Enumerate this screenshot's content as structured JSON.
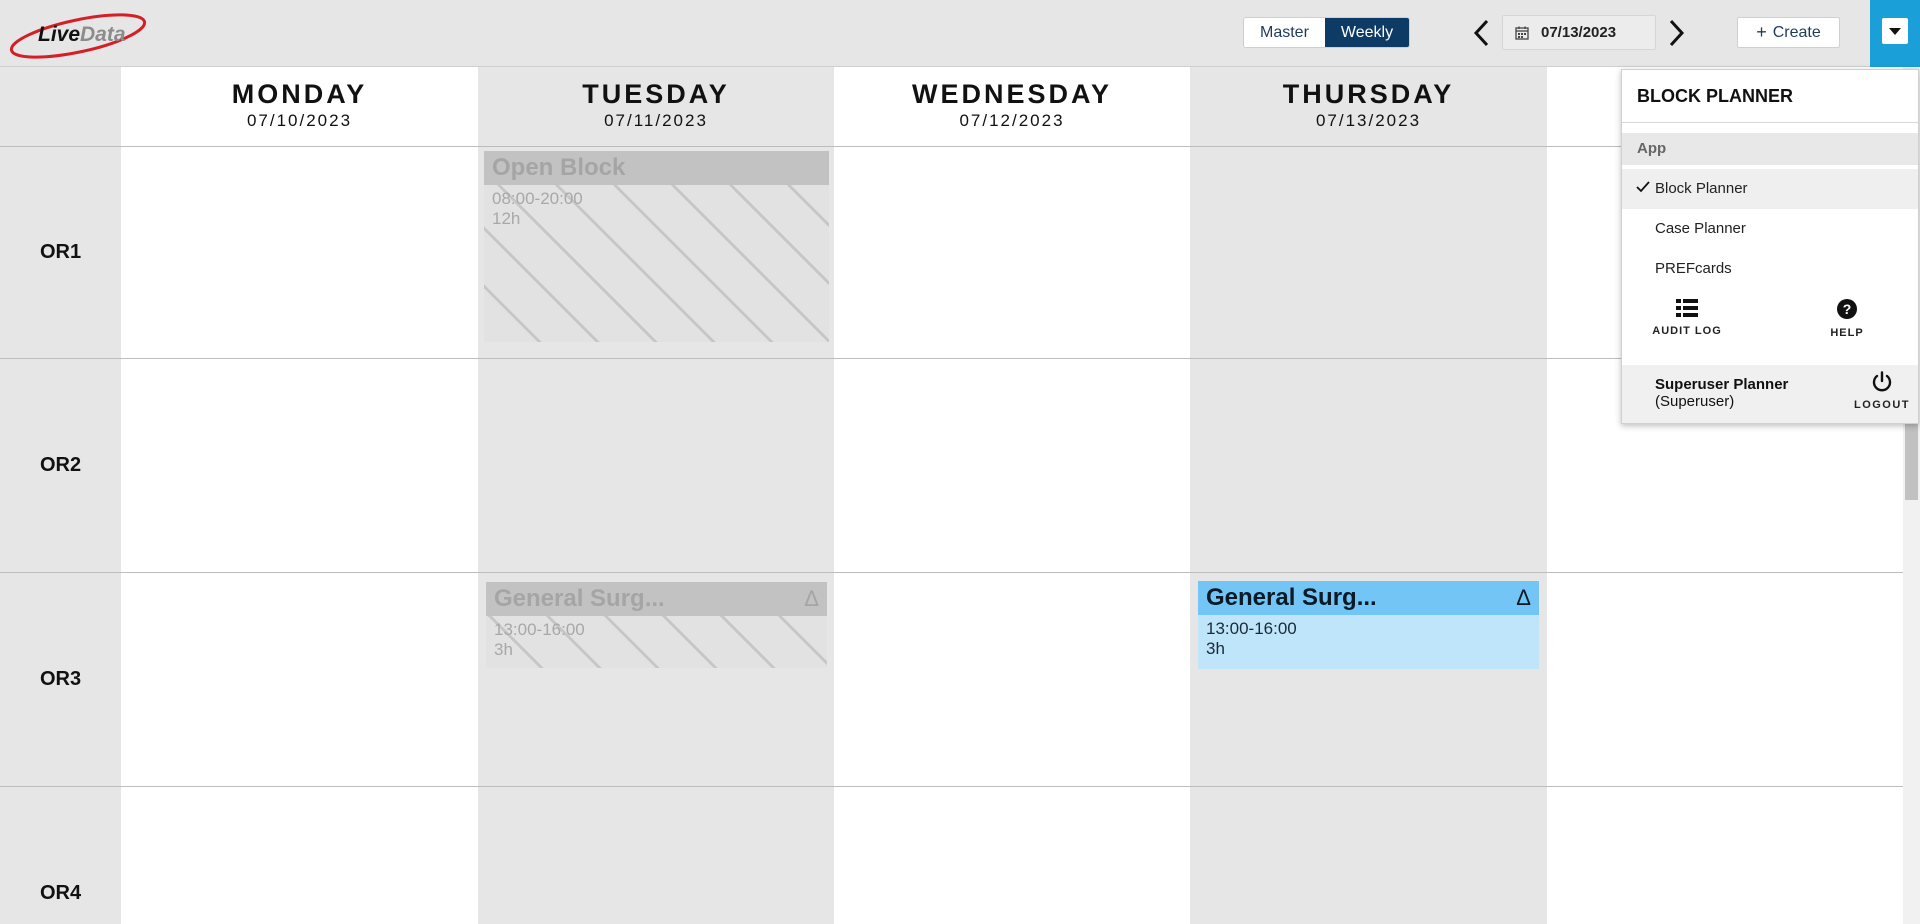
{
  "header": {
    "logo_text": "LiveData",
    "view_toggle": {
      "master_label": "Master",
      "weekly_label": "Weekly",
      "active": "Weekly"
    },
    "prev_icon": "chevron-left-icon",
    "next_icon": "chevron-right-icon",
    "date_value": "07/13/2023",
    "create_label": "Create",
    "menu_icon": "caret-down-icon"
  },
  "days": [
    {
      "name": "MONDAY",
      "date": "07/10/2023"
    },
    {
      "name": "TUESDAY",
      "date": "07/11/2023"
    },
    {
      "name": "WEDNESDAY",
      "date": "07/12/2023"
    },
    {
      "name": "THURSDAY",
      "date": "07/13/2023"
    }
  ],
  "rooms": [
    "OR1",
    "OR2",
    "OR3",
    "OR4"
  ],
  "blocks": [
    {
      "title": "Open Block",
      "time": "08:00-20:00",
      "duration": "12h",
      "day": "TUESDAY",
      "room": "OR1",
      "style": "ghost"
    },
    {
      "title": "General Surg...",
      "time": "13:00-16:00",
      "duration": "3h",
      "day": "TUESDAY",
      "room": "OR3",
      "style": "ghost",
      "marker": "Δ"
    },
    {
      "title": "General Surg...",
      "time": "13:00-16:00",
      "duration": "3h",
      "day": "THURSDAY",
      "room": "OR3",
      "style": "active",
      "marker": "Δ"
    }
  ],
  "menu": {
    "title": "BLOCK PLANNER",
    "section": "App",
    "items": [
      {
        "label": "Block Planner",
        "selected": true
      },
      {
        "label": "Case Planner",
        "selected": false
      },
      {
        "label": "PREFcards",
        "selected": false
      }
    ],
    "audit_label": "AUDIT LOG",
    "help_label": "HELP",
    "user_name": "Superuser Planner",
    "user_role": "(Superuser)",
    "logout_label": "LOGOUT"
  },
  "colors": {
    "accent": "#0d3b66",
    "menu_button": "#1a9fd9",
    "active_block": "#73c5f6"
  }
}
